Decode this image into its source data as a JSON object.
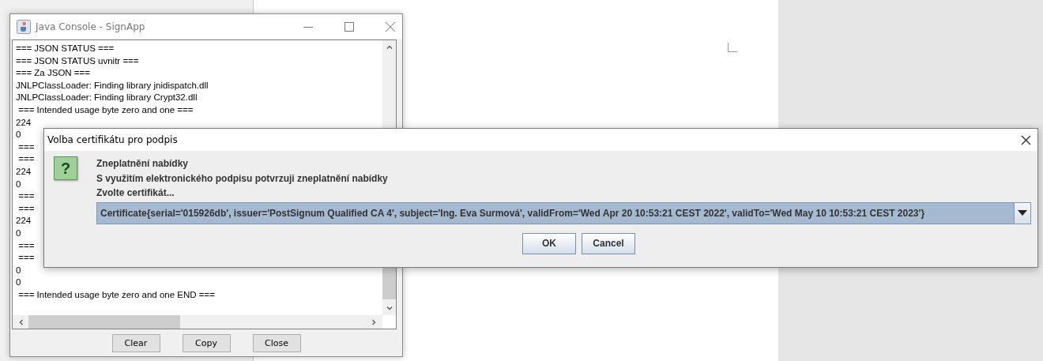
{
  "console": {
    "title": "Java Console - SignApp",
    "lines": [
      "=== JSON STATUS ===",
      "=== JSON STATUS uvnitr ===",
      "=== Za JSON ===",
      "JNLPClassLoader: Finding library jnidispatch.dll",
      "JNLPClassLoader: Finding library Crypt32.dll",
      " === Intended usage byte zero and one ===",
      "224",
      "0",
      " ===",
      " ===",
      "224",
      "0",
      " ===",
      " ===",
      "224",
      "0",
      " ===",
      " ===",
      "0",
      "0",
      " === Intended usage byte zero and one END ==="
    ],
    "buttons": [
      "Clear",
      "Copy",
      "Close"
    ]
  },
  "dialog": {
    "title": "Volba certifikátu pro podpis",
    "icon_glyph": "?",
    "heading": "Zneplatnění nabídky",
    "message": "S využitím elektronického podpisu potvrzuji zneplatnění nabídky",
    "prompt": "Zvolte certifikát...",
    "certificate_select": {
      "value": "Certificate{serial='015926db', issuer='PostSignum Qualified CA 4', subject='Ing. Eva Surmová', validFrom='Wed Apr 20 10:53:21 CEST 2022', validTo='Wed May 10 10:53:21 CEST 2023'}"
    },
    "buttons": [
      "OK",
      "Cancel"
    ]
  }
}
